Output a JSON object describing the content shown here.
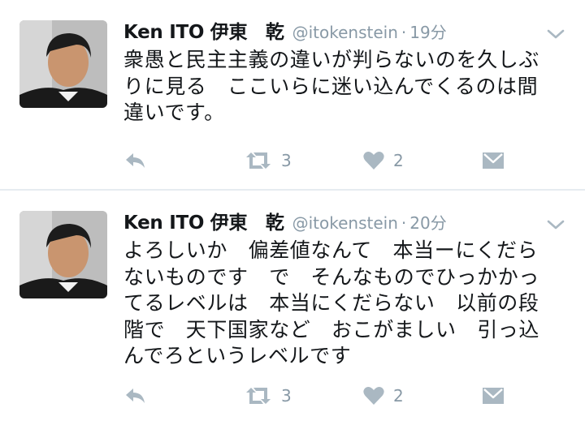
{
  "tweets": [
    {
      "name": "Ken ITO 伊東　乾",
      "handle": "@itokenstein",
      "separator": "·",
      "time": "19分",
      "lines": [
        "衆愚と民主主義の違いが判らないのを久しぶ",
        "りに見る　ここいらに迷い込んでくるのは間",
        "違いです。"
      ],
      "retweet_count": "3",
      "like_count": "2",
      "icons": [
        "avatar-photo",
        "chevron-down-icon",
        "reply-icon",
        "retweet-icon",
        "heart-icon",
        "direct-message-icon"
      ]
    },
    {
      "name": "Ken ITO 伊東　乾",
      "handle": "@itokenstein",
      "separator": "·",
      "time": "20分",
      "lines": [
        "よろしいか　偏差値なんて　本当ーにくだら",
        "ないものです　で　そんなものでひっかかっ",
        "てるレベルは　本当にくだらない　以前の段",
        "階で　天下国家など　おこがましい　引っ込",
        "んでろというレベルです"
      ],
      "retweet_count": "3",
      "like_count": "2",
      "icons": [
        "avatar-photo",
        "chevron-down-icon",
        "reply-icon",
        "retweet-icon",
        "heart-icon",
        "direct-message-icon"
      ]
    }
  ],
  "colors": {
    "text": "#14171a",
    "secondary": "#8899a6",
    "icon": "#aab8c2",
    "divider": "#e6ecf0"
  }
}
